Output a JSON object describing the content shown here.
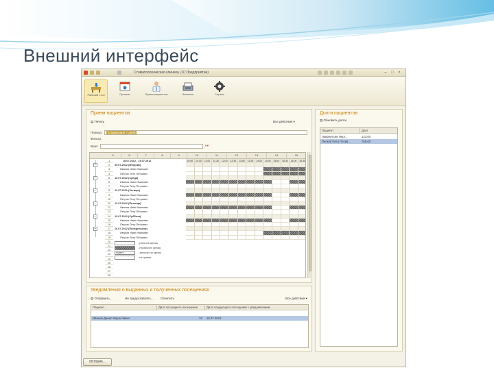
{
  "slide": {
    "title": "Внешний интерфейс"
  },
  "window": {
    "title": "Стоматологическая клиника (1С:Предприятие)"
  },
  "toolbar": {
    "items": [
      {
        "label": "Рабочий стол",
        "icon": "desk-icon"
      },
      {
        "label": "Приемы",
        "icon": "calendar-icon"
      },
      {
        "label": "Прием пациентов",
        "icon": "doctor-icon"
      },
      {
        "label": "Финансы",
        "icon": "cash-register-icon"
      },
      {
        "label": "Сервис",
        "icon": "gear-icon"
      }
    ]
  },
  "reception": {
    "title": "Прием пациентов",
    "print_label": "Печать",
    "actions_label": "Все действия ▾",
    "period_label": "Период:",
    "period_value": "Следующие 7 дней",
    "filter_label": "Фильтр:",
    "doctor_label": "Врач:",
    "header_range": "18.07.2012 - 15.07.2012",
    "columns": [
      "9",
      "8",
      "7",
      "8",
      "9",
      "10",
      "11",
      "12",
      "13",
      "14",
      "15"
    ],
    "row_numbers": [
      "1",
      "2",
      "3",
      "4",
      "5",
      "6",
      "7",
      "8",
      "9",
      "10",
      "11",
      "12",
      "13",
      "14",
      "15",
      "16",
      "17",
      "18",
      "19",
      "20",
      "21",
      "22",
      "23",
      "24",
      "25",
      "26",
      "27",
      "28",
      "29"
    ],
    "rows": [
      {
        "text": "09.07.2012 (Вторник)",
        "date": true
      },
      {
        "text": "Иванов Иван Иванович"
      },
      {
        "text": "Петров Петр Петрович"
      },
      {
        "text": "10.07.2012 (Среда)",
        "date": true
      },
      {
        "text": "Иванов Иван Иванович"
      },
      {
        "text": "Петров Петр Петрович"
      },
      {
        "text": "11.07.2012 (Четверг)",
        "date": true
      },
      {
        "text": "Иванов Иван Иванович"
      },
      {
        "text": "Петров Петр Петрович"
      },
      {
        "text": "12.07.2012 (Пятница)",
        "date": true
      },
      {
        "text": "Иванов Иван Иванович"
      },
      {
        "text": "Петров Петр Петрович"
      },
      {
        "text": "13.07.2012 (Суббота)",
        "date": true
      },
      {
        "text": "Иванов Иван Иванович"
      },
      {
        "text": "Петров Петр Петрович"
      },
      {
        "text": "16.07.2012 (Понедельник)",
        "date": true
      },
      {
        "text": "Иванов Иван Иванович"
      },
      {
        "text": "Петров Петр Петрович"
      }
    ],
    "time_slots": [
      "10:00",
      "10:30",
      "11:00",
      "11:30",
      "12:00",
      "12:30",
      "13:00",
      "13:30",
      "14:00",
      "14:30",
      "15:00",
      "15:30",
      "16:00",
      "16:30"
    ],
    "legend": [
      {
        "swatch": "",
        "text": "- рабочее время"
      },
      {
        "swatch": "",
        "text": "- нерабочее время"
      },
      {
        "swatch": "талант",
        "text": "- записан на время"
      },
      {
        "swatch": "",
        "text": "- не принят"
      }
    ]
  },
  "debts": {
    "title": "Долги пациентов",
    "refresh_label": "Обновить долги",
    "columns": [
      "Пациент",
      "Долг"
    ],
    "rows": [
      {
        "patient": "Лаврентьев Перт...",
        "amount": "123,00"
      },
      {
        "patient": "Песков Петр Петрв...",
        "amount": "758,00"
      }
    ]
  },
  "notices": {
    "title": "Уведомления о выданных и полученных посещениях",
    "send_label": "Отправить...",
    "check_label": "Не предоставлять...",
    "mark_label": "Отметить",
    "actions_label": "Все действия ▾",
    "columns": [
      "Пациент",
      "Дата последнего посещения",
      "Дата следующего посещения с уведомлением"
    ],
    "rows": [
      {
        "patient": "Иванов Денис Мирославич",
        "last": "21",
        "next": "18.07.2012"
      }
    ]
  },
  "status": {
    "history_label": "История..."
  },
  "colors": {
    "accent_orange": "#c5820a",
    "selection": "#b4c8e4",
    "window_bg": "#f4f1e6"
  }
}
